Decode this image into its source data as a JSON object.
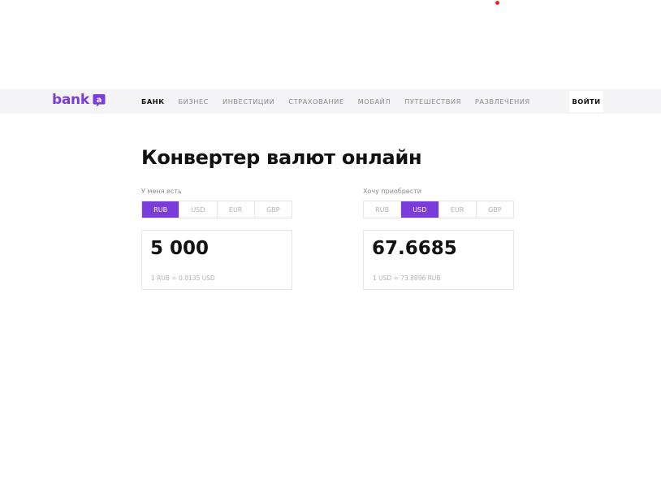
{
  "header": {
    "logo_text": "bank",
    "logo_mark_letter": "a",
    "nav": [
      {
        "label": "БАНК",
        "active": true
      },
      {
        "label": "БИЗНЕС",
        "active": false
      },
      {
        "label": "ИНВЕСТИЦИИ",
        "active": false
      },
      {
        "label": "СТРАХОВАНИЕ",
        "active": false
      },
      {
        "label": "МОБАЙЛ",
        "active": false
      },
      {
        "label": "ПУТЕШЕСТВИЯ",
        "active": false
      },
      {
        "label": "РАЗВЛЕЧЕНИЯ",
        "active": false
      }
    ],
    "login_label": "ВОЙТИ"
  },
  "main": {
    "title": "Конвертер валют онлайн",
    "from": {
      "label": "У меня есть",
      "currencies": [
        "RUB",
        "USD",
        "EUR",
        "GBP"
      ],
      "selected": "RUB",
      "amount": "5 000",
      "rate": "1 RUB = 0.0135 USD"
    },
    "to": {
      "label": "Хочу приобрести",
      "currencies": [
        "RUB",
        "USD",
        "EUR",
        "GBP"
      ],
      "selected": "USD",
      "amount": "67.6685",
      "rate": "1 USD = 73.8896 RUB"
    }
  },
  "colors": {
    "brand": "#7a3ddb",
    "header_bg": "#f4f4f6",
    "notification_dot": "#e3262a"
  },
  "icons": {
    "notification": "red-dot",
    "logo_mark": "speech-bubble-a-icon"
  }
}
